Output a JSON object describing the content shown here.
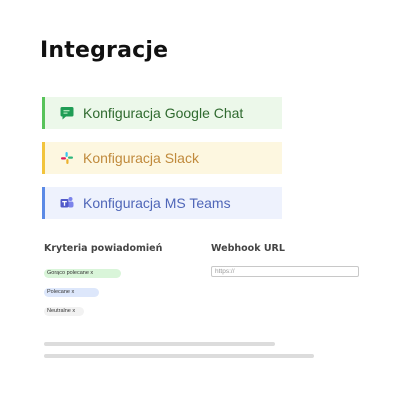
{
  "page": {
    "title": "Integracje"
  },
  "integrations": [
    {
      "label": "Konfiguracja Google Chat",
      "icon": "google-chat-icon",
      "accent": "#58c35a"
    },
    {
      "label": "Konfiguracja Slack",
      "icon": "slack-icon",
      "accent": "#f2c43c"
    },
    {
      "label": "Konfiguracja MS Teams",
      "icon": "ms-teams-icon",
      "accent": "#5b8ae6"
    }
  ],
  "criteria": {
    "label": "Kryteria powiadomień",
    "tags": [
      {
        "label": "Gorąco polecane x",
        "color": "#d9f5d9"
      },
      {
        "label": "Polecane x",
        "color": "#dde7fb"
      },
      {
        "label": "Neutralne x",
        "color": "#f2f2f2"
      }
    ]
  },
  "webhook": {
    "label": "Webhook URL",
    "placeholder": "https://"
  }
}
